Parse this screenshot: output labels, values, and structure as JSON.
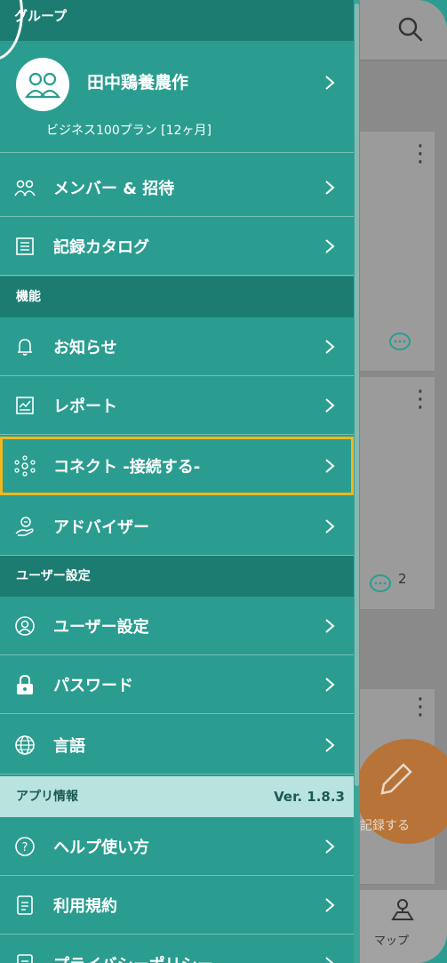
{
  "drawer": {
    "group_section": "グループ",
    "group_name": "田中鶏養農作",
    "plan": "ビジネス100プラン [12ヶ月]",
    "group_items": [
      {
        "label": "メンバー & 招待",
        "icon": "members-icon"
      },
      {
        "label": "記録カタログ",
        "icon": "list-icon"
      }
    ],
    "features_section": "機能",
    "feature_items": [
      {
        "label": "お知らせ",
        "icon": "bell-icon"
      },
      {
        "label": "レポート",
        "icon": "report-icon"
      },
      {
        "label": "コネクト -接続する-",
        "icon": "connect-icon"
      },
      {
        "label": "アドバイザー",
        "icon": "advisor-icon"
      }
    ],
    "user_section": "ユーザー設定",
    "user_items": [
      {
        "label": "ユーザー設定",
        "icon": "user-icon"
      },
      {
        "label": "パスワード",
        "icon": "lock-icon"
      },
      {
        "label": "言語",
        "icon": "globe-icon"
      }
    ],
    "app_section": "アプリ情報",
    "version": "Ver. 1.8.3",
    "app_items": [
      {
        "label": "ヘルプ使い方",
        "icon": "help-icon"
      },
      {
        "label": "利用規約",
        "icon": "document-icon"
      },
      {
        "label": "プライバシーポリシー",
        "icon": "document-icon"
      }
    ]
  },
  "background": {
    "comment_count": "2",
    "fab_label": "記録する",
    "map_label": "マップ"
  },
  "colors": {
    "drawer_bg": "#2a9d90",
    "section_bg": "#1c7c71",
    "highlight": "#f2b71c"
  }
}
